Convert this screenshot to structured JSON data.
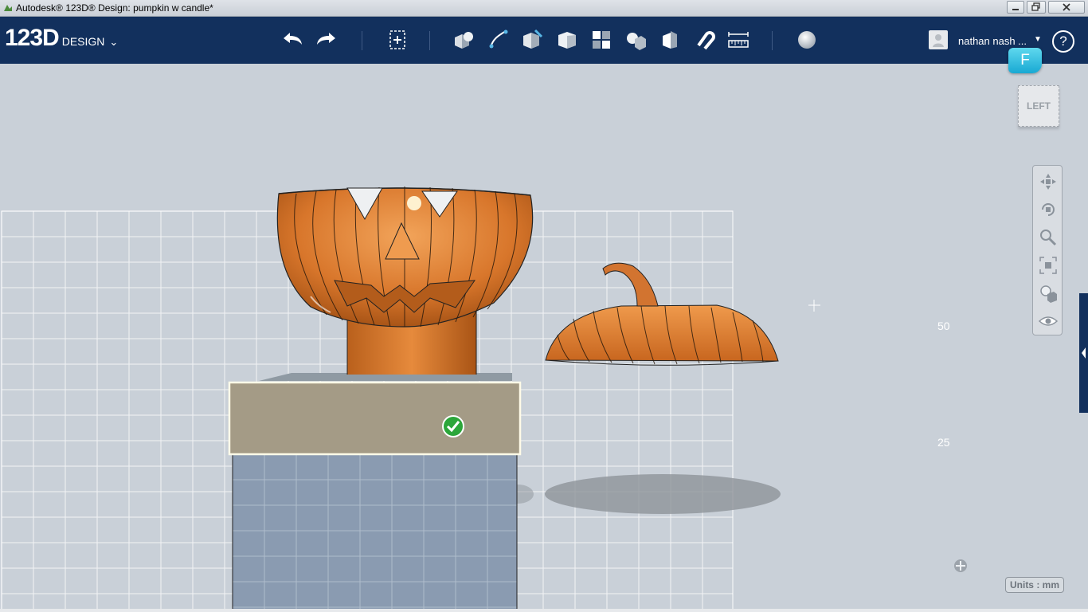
{
  "window": {
    "title": "Autodesk® 123D® Design: pumpkin w candle*"
  },
  "toolbar": {
    "logo_main": "123D",
    "logo_sub": "DESIGN",
    "logo_caret": "⌄",
    "user_name": "nathan nash ...",
    "user_caret": "▼",
    "help_label": "?"
  },
  "badge": {
    "label": "F"
  },
  "viewcube": {
    "face": "LEFT"
  },
  "ruler": {
    "mark_50": "50",
    "mark_25": "25"
  },
  "status": {
    "units": "Units : mm"
  },
  "colors": {
    "toolbar": "#12305d",
    "pumpkin": "#d8762b",
    "accent": "#1fb1da",
    "confirm": "#2ca63a"
  }
}
